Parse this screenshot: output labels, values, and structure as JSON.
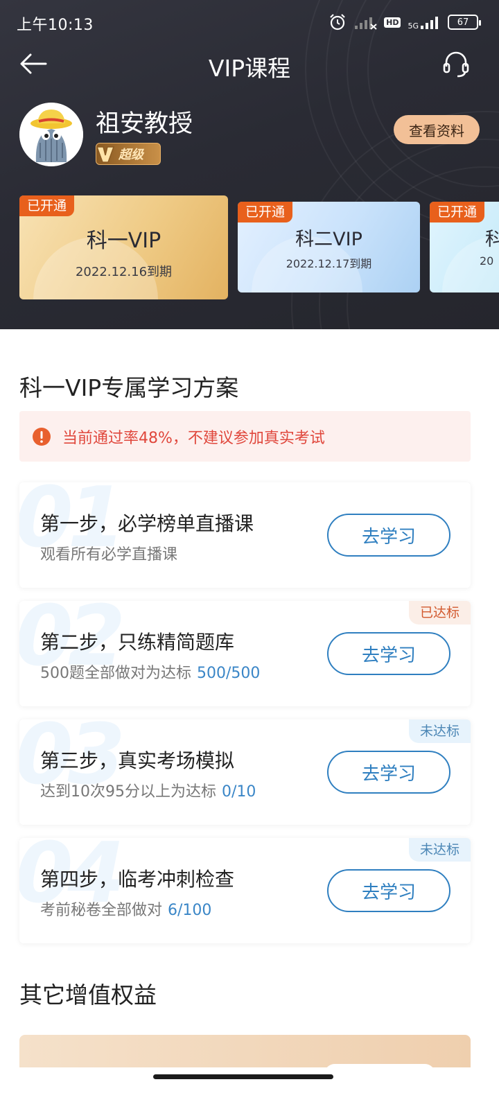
{
  "status_bar": {
    "time": "上午10:13",
    "hd": "HD",
    "network": "5G",
    "battery": "67"
  },
  "nav": {
    "title": "VIP课程"
  },
  "profile": {
    "name": "祖安教授",
    "vip_level": "超级",
    "view_profile_label": "查看资料"
  },
  "vip_cards": [
    {
      "tag": "已开通",
      "title": "科一VIP",
      "expiry": "2022.12.16到期"
    },
    {
      "tag": "已开通",
      "title": "科二VIP",
      "expiry": "2022.12.17到期"
    },
    {
      "tag": "已开通",
      "title": "科",
      "expiry": "20"
    }
  ],
  "plan": {
    "title": "科一VIP专属学习方案",
    "warning": "当前通过率48%，不建议参加真实考试",
    "steps": [
      {
        "num": "01",
        "title": "第一步，必学榜单直播课",
        "desc": "观看所有必学直播课",
        "progress": "",
        "status": "",
        "button": "去学习"
      },
      {
        "num": "02",
        "title": "第二步，只练精简题库",
        "desc": "500题全部做对为达标",
        "progress": "500/500",
        "status": "已达标",
        "button": "去学习"
      },
      {
        "num": "03",
        "title": "第三步，真实考场模拟",
        "desc": "达到10次95分以上为达标",
        "progress": "0/10",
        "status": "未达标",
        "button": "去学习"
      },
      {
        "num": "04",
        "title": "第四步，临考冲刺检查",
        "desc": "考前秘卷全部做对",
        "progress": "6/100",
        "status": "未达标",
        "button": "去学习"
      }
    ]
  },
  "benefits": {
    "title": "其它增值权益"
  },
  "colors": {
    "header_bg": "#2a2b34",
    "accent_blue": "#2f7fc0",
    "warning_red": "#e0473c",
    "tag_orange": "#e8601c"
  },
  "icons": [
    "back-arrow-icon",
    "headset-icon",
    "alarm-icon",
    "signal-icon",
    "warning-icon",
    "vip-v-icon"
  ]
}
